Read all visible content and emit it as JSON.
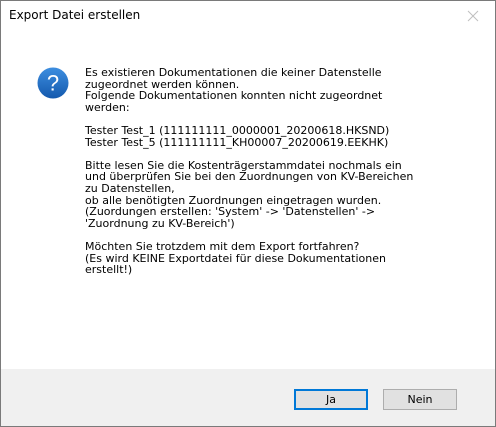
{
  "window": {
    "title": "Export Datei erstellen",
    "close_icon": "close-icon"
  },
  "icon": {
    "name": "question-icon",
    "color": "#1f6fc5"
  },
  "message": {
    "lines": [
      "Es existieren Dokumentationen die keiner Datenstelle",
      "zugeordnet werden können.",
      "Folgende Dokumentationen konnten nicht zugeordnet",
      "werden:",
      "",
      "Tester Test_1 (111111111_0000001_20200618.HKSND)",
      "Tester Test_5 (111111111_KH00007_20200619.EEKHK)",
      "",
      "Bitte lesen Sie die Kostenträgerstammdatei nochmals ein",
      "und überprüfen Sie bei den Zuordnungen von KV-Bereichen",
      "zu Datenstellen,",
      "ob alle benötigten Zuordnungen eingetragen wurden.",
      "(Zuordungen erstellen: 'System' -> 'Datenstellen' ->",
      "'Zuordnung zu KV-Bereich')",
      "",
      "Möchten Sie trotzdem mit dem Export fortfahren?",
      "(Es wird KEINE Exportdatei für diese Dokumentationen",
      "erstellt!)"
    ]
  },
  "buttons": {
    "yes_label": "Ja",
    "no_label": "Nein"
  },
  "colors": {
    "footer_bg": "#f0f0f0",
    "default_button_border": "#0078d7"
  }
}
